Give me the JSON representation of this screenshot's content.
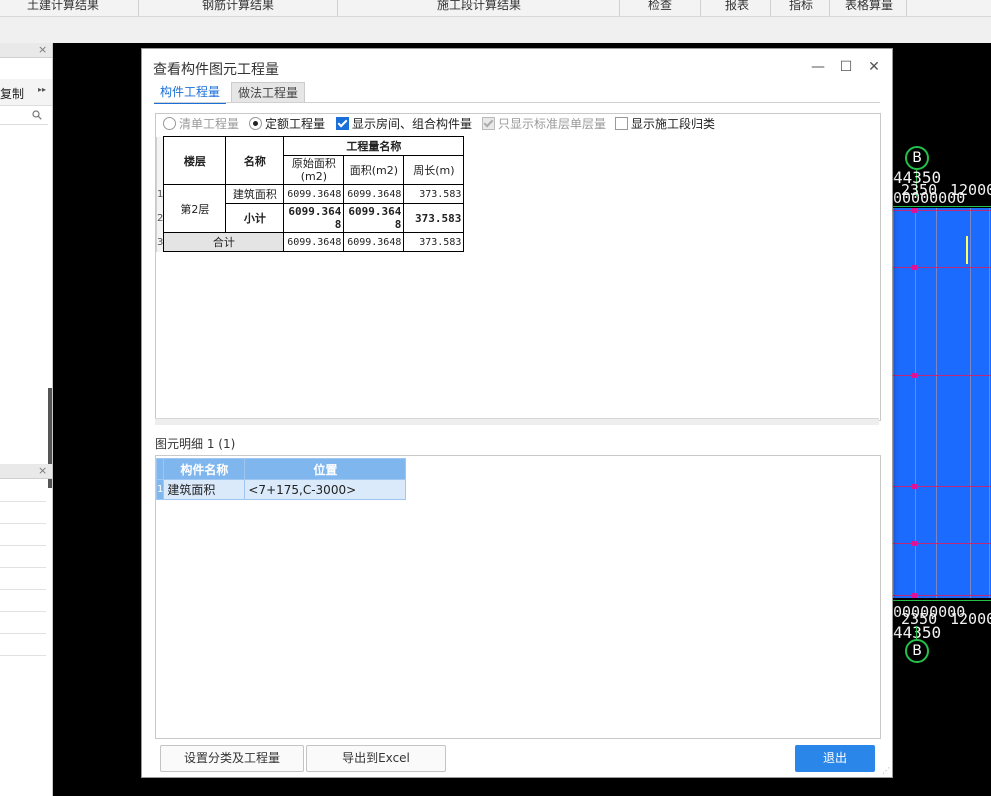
{
  "menu": {
    "items": [
      "土建计算结果",
      "钢筋计算结果",
      "施工段计算结果",
      "检查",
      "报表",
      "指标",
      "表格算量"
    ]
  },
  "left_panel": {
    "copy_label": "复制",
    "expand_glyph": "▸▸",
    "search_icon": "search-icon",
    "close_glyph": "×"
  },
  "cad": {
    "axis_label": "B",
    "dim_top_1": "44350",
    "dim_top_2": "2350",
    "dim_top_3": "12000",
    "dim_top_4": "00000000",
    "dim_bottom_1": "00000000",
    "dim_bottom_2": "2350",
    "dim_bottom_3": "12000",
    "dim_bottom_4": "44350",
    "colors": {
      "background": "#000000",
      "fill": "#1c6bff",
      "axis": "#23c04a",
      "grid": "#c0287a"
    }
  },
  "dialog": {
    "title": "查看构件图元工程量",
    "minimize": "—",
    "maximize": "☐",
    "close": "✕",
    "tabs": [
      "构件工程量",
      "做法工程量"
    ],
    "options": {
      "bill_qty": "清单工程量",
      "quota_qty": "定额工程量",
      "show_rooms": "显示房间、组合构件量",
      "std_floor_only": "只显示标准层单层量",
      "show_segments": "显示施工段归类"
    },
    "qty_table": {
      "col_floor": "楼层",
      "col_name": "名称",
      "group_header": "工程量名称",
      "col_orig_area": "原始面积(m2)",
      "col_area": "面积(m2)",
      "col_perimeter": "周长(m)",
      "row_numbers": [
        "1",
        "2",
        "3"
      ],
      "floor": "第2层",
      "rows": [
        {
          "name": "建筑面积",
          "orig_area": "6099.3648",
          "area": "6099.3648",
          "perimeter": "373.583"
        },
        {
          "name": "小计",
          "orig_area": "6099.3648",
          "area": "6099.3648",
          "perimeter": "373.583"
        }
      ],
      "total": {
        "name": "合计",
        "orig_area": "6099.3648",
        "area": "6099.3648",
        "perimeter": "373.583"
      }
    },
    "detail": {
      "label": "图元明细  1 (1)",
      "col_component": "构件名称",
      "col_position": "位置",
      "rows": [
        {
          "no": "1",
          "component": "建筑面积",
          "position": "<7+175,C-3000>"
        }
      ]
    },
    "buttons": {
      "set_category": "设置分类及工程量",
      "export_excel": "导出到Excel",
      "exit": "退出"
    },
    "accent_color": "#2a86e8"
  }
}
